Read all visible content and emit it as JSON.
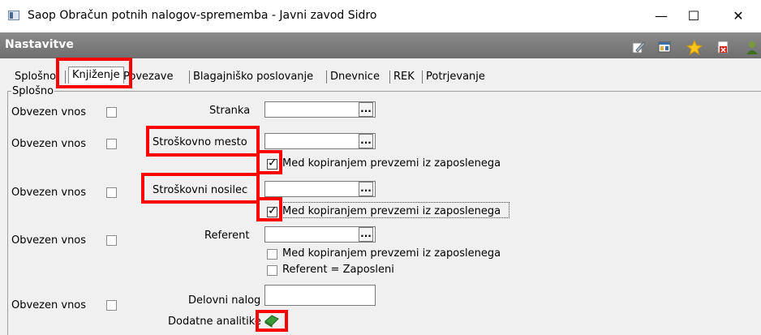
{
  "window": {
    "title": "Saop Obračun potnih nalogov-sprememba - Javni zavod Sidro",
    "minimize": "—",
    "maximize": "☐",
    "close": "✕"
  },
  "section_bar": {
    "title": "Nastavitve"
  },
  "toolbar": {
    "edit_icon": "edit-icon",
    "columns_icon": "columns-icon",
    "favorite_icon": "star-icon",
    "delete_icon": "delete-icon",
    "user_icon": "user-icon"
  },
  "tabs": [
    "Splošno",
    "Knjiženje",
    "Povezave",
    "Blagajniško poslovanje",
    "Dnevnice",
    "REK",
    "Potrjevanje"
  ],
  "group": {
    "label": "Splošno"
  },
  "rows": {
    "stranka": {
      "required_label": "Obvezen vnos",
      "label": "Stranka",
      "value": ""
    },
    "strosek_mesto": {
      "required_label": "Obvezen vnos",
      "label": "Stroškovno mesto",
      "value": "",
      "copy_label": "Med kopiranjem prevzemi iz zaposlenega"
    },
    "strosek_nosilec": {
      "required_label": "Obvezen vnos",
      "label": "Stroškovni nosilec",
      "value": "",
      "copy_label": "Med kopiranjem prevzemi iz zaposlenega"
    },
    "referent": {
      "required_label": "Obvezen vnos",
      "label": "Referent",
      "value": "",
      "copy_label": "Med kopiranjem prevzemi iz zaposlenega",
      "same_label": "Referent = Zaposleni"
    },
    "delovni_nalog": {
      "required_label": "Obvezen vnos",
      "label": "Delovni nalog",
      "value": ""
    },
    "dodatne": {
      "label": "Dodatne analitike"
    }
  },
  "button_dots": "...",
  "colors": {
    "highlight": "#ff0000",
    "bar": "#7a7a7a"
  }
}
